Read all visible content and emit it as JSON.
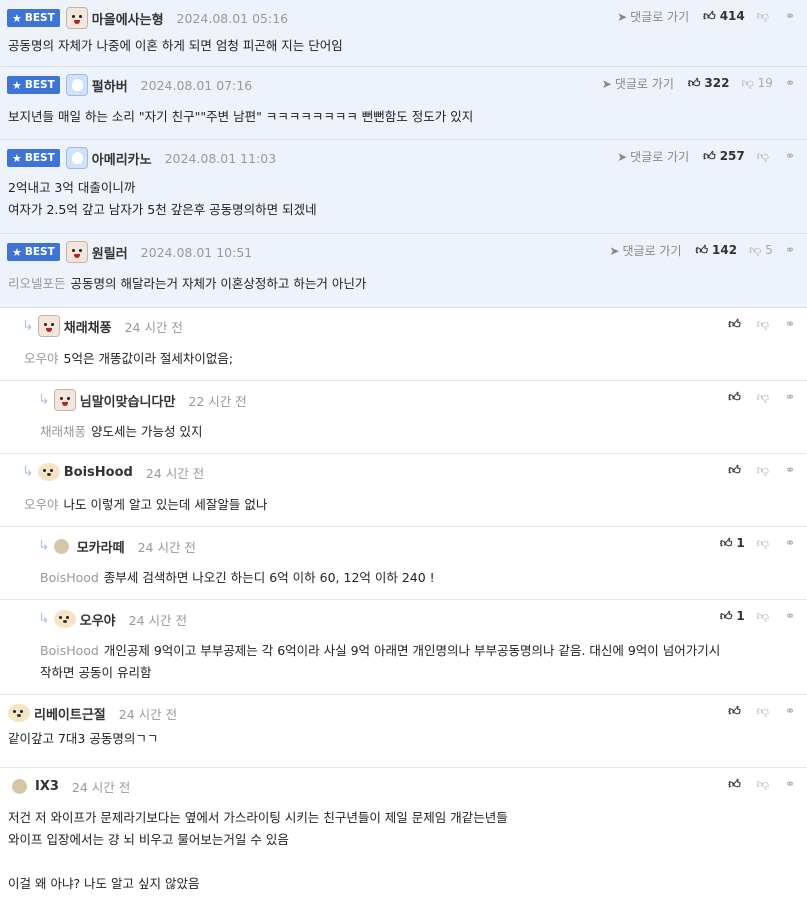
{
  "labels": {
    "best": "BEST",
    "goto_reply": "댓글로 가기"
  },
  "comments": [
    {
      "nick": "마을에사는형",
      "date": "2024.08.01 05:16",
      "likes": "414",
      "dislikes": "",
      "lines": [
        "공동명의 자체가 나중에 이혼 하게 되면 엄청 피곤해 지는 단어임"
      ]
    },
    {
      "nick": "펄하버",
      "date": "2024.08.01 07:16",
      "likes": "322",
      "dislikes": "19",
      "lines": [
        "보지년들 매일 하는 소리 \"자기 친구\"\"주변 남편\" ㅋㅋㅋㅋㅋㅋㅋㅋ 뻔뻔함도 정도가 있지"
      ]
    },
    {
      "nick": "아메리카노",
      "date": "2024.08.01 11:03",
      "likes": "257",
      "dislikes": "",
      "lines": [
        "2억내고 3억 대출이니까",
        "여자가 2.5억 갚고 남자가 5천 갚은후 공동명의하면 되겠네"
      ]
    },
    {
      "nick": "원릴러",
      "date": "2024.08.01 10:51",
      "likes": "142",
      "dislikes": "5",
      "mention": "리오넬포든",
      "lines": [
        "공동명의 해달라는거 자체가 이혼상정하고 하는거 아닌가"
      ]
    },
    {
      "nick": "채래채퐁",
      "date": "24 시간 전",
      "likes": "",
      "mention": "오우야",
      "lines": [
        "5억은 개똥값이라 절세차이없음;"
      ]
    },
    {
      "nick": "님말이맞습니다만",
      "date": "22 시간 전",
      "likes": "",
      "mention": "채래채퐁",
      "lines": [
        "양도세는 가능성 있지"
      ]
    },
    {
      "nick": "BoisHood",
      "date": "24 시간 전",
      "likes": "",
      "mention": "오우야",
      "lines": [
        "나도 이렇게 알고 있는데 세잘알들 없나"
      ]
    },
    {
      "nick": "모카라떼",
      "date": "24 시간 전",
      "likes": "1",
      "mention": "BoisHood",
      "lines": [
        "종부세 검색하면 나오긴 하는디 6억 이하 60, 12억 이하 240 !"
      ]
    },
    {
      "nick": "오우야",
      "date": "24 시간 전",
      "likes": "1",
      "mention": "BoisHood",
      "lines": [
        "개인공제 9억이고 부부공제는 각 6억이라 사실 9억 아래면 개인명의나 부부공동명의나 같음. 대신에 9억이 넘어가기시",
        "작하면 공동이 유리함"
      ]
    },
    {
      "nick": "리베이트근절",
      "date": "24 시간 전",
      "likes": "",
      "lines": [
        "같이갚고 7대3 공동명의ㄱㄱ"
      ]
    },
    {
      "nick": "IX3",
      "date": "24 시간 전",
      "likes": "",
      "lines": [
        "저건 저 와이프가 문제라기보다는 옆에서 가스라이팅 시키는 친구년들이 제일 문제임 개같는년들",
        "와이프 입장에서는 걍 뇌 비우고 물어보는거일 수 있음",
        "",
        "이걸 왜 아냐? 나도 알고 싶지 않았음"
      ]
    }
  ]
}
